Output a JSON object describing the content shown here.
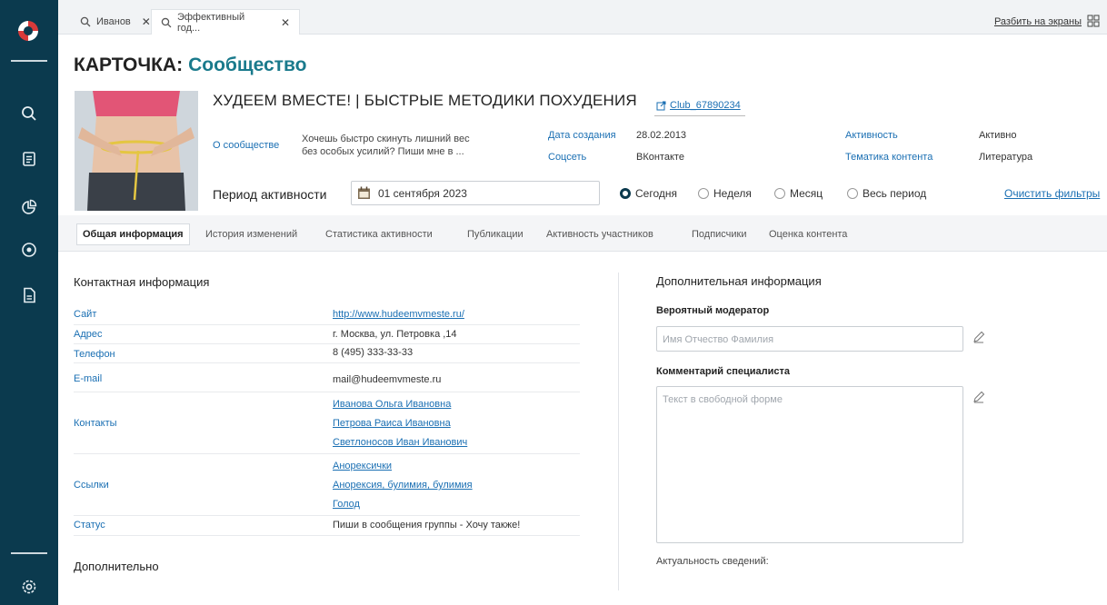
{
  "browser_tabs": [
    {
      "label": "Иванов",
      "close": "✕"
    },
    {
      "label": "Эффективный год...",
      "close": "✕"
    }
  ],
  "split_screen_label": "Разбить на экраны",
  "page": {
    "title_label": "КАРТОЧКА:",
    "title_value": "Сообщество"
  },
  "community": {
    "name": "ХУДЕЕМ ВМЕСТЕ! | БЫСТРЫЕ МЕТОДИКИ ПОХУДЕНИЯ",
    "club_id": "Club_67890234",
    "about_label": "О сообществе",
    "about_text_1": "Хочешь быстро скинуть лишний вес",
    "about_text_2": "без особых усилий? Пиши мне в ..."
  },
  "meta": {
    "created_label": "Дата создания",
    "created_value": "28.02.2013",
    "network_label": "Соцсеть",
    "network_value": "ВКонтакте",
    "activity_label": "Активность",
    "activity_value": "Активно",
    "theme_label": "Тематика контента",
    "theme_value": "Литература"
  },
  "period": {
    "label": "Период активности",
    "date": "01 сентября  2023",
    "options": [
      "Сегодня",
      "Неделя",
      "Месяц",
      "Весь период"
    ],
    "selected": "Сегодня",
    "clear": "Очистить фильтры"
  },
  "content_tabs": [
    "Общая информация",
    "История изменений",
    "Статистика активности",
    "Публикации",
    "Активность участников",
    "Подписчики",
    "Оценка контента"
  ],
  "contact": {
    "heading": "Контактная информация",
    "site_label": "Сайт",
    "site_value": "http://www.hudeemvmeste.ru/",
    "address_label": "Адрес",
    "address_value": "г. Москва, ул. Петровка ,14",
    "phone_label": "Телефон",
    "phone_value": "8 (495) 333-33-33",
    "email_label": "E-mail",
    "email_value": "mail@hudeemvmeste.ru",
    "contacts_label": "Контакты",
    "contacts": [
      "Иванова Ольга Ивановна",
      "Петрова Раиса Ивановна",
      "Светлоносов Иван Иванович"
    ],
    "links_label": "Ссылки",
    "links": [
      "Анорексички",
      "Анорексия, булимия, булимия",
      "Голод"
    ],
    "status_label": "Статус",
    "status_value": "Пиши в сообщения группы - Хочу также!",
    "extra_heading": "Дополнительно"
  },
  "additional": {
    "heading": "Дополнительная информация",
    "moderator_label": "Вероятный модератор",
    "moderator_placeholder": "Имя Отчество Фамилия",
    "comment_label": "Комментарий специалиста",
    "comment_placeholder": "Текст в свободной форме",
    "actuality_label": "Актуальность сведений:"
  },
  "colors": {
    "sidebar": "#0b3a4e",
    "accent": "#1a7a8c",
    "link": "#1a6fb3",
    "logo_red": "#d83a3a"
  }
}
